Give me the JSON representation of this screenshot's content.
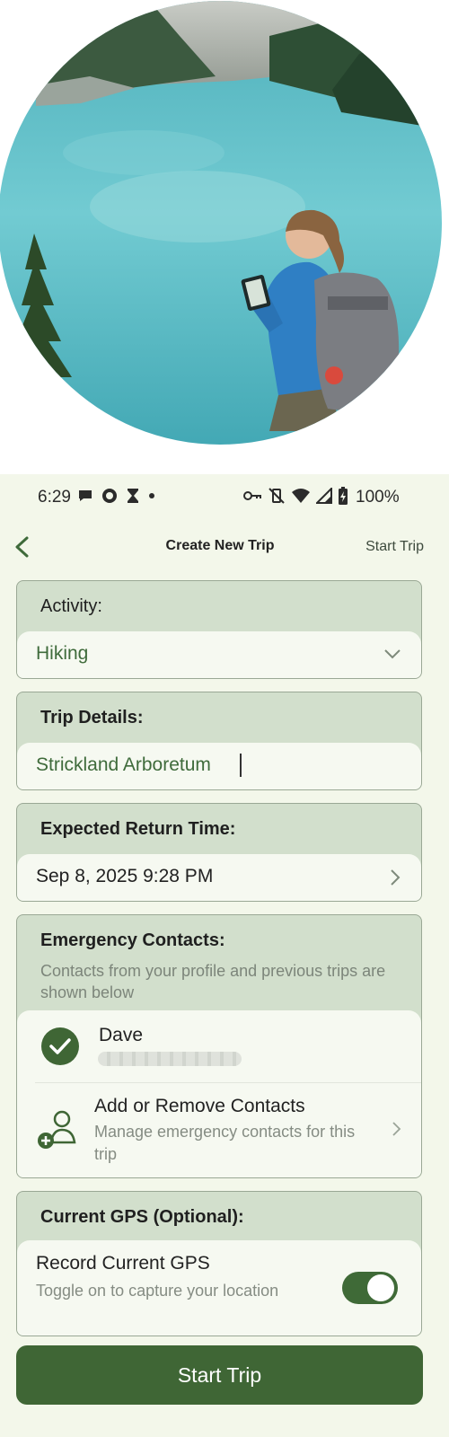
{
  "status_bar": {
    "time": "6:29",
    "battery": "100%",
    "icons_left": [
      "chat-bubble-icon",
      "gear-badge-icon",
      "hourglass-icon",
      "dot-icon"
    ],
    "icons_right": [
      "key-icon",
      "vibrate-off-icon",
      "wifi-icon",
      "signal-icon",
      "battery-icon"
    ]
  },
  "nav": {
    "title": "Create New Trip",
    "action": "Start Trip"
  },
  "activity": {
    "label": "Activity:",
    "value": "Hiking"
  },
  "trip_details": {
    "label": "Trip Details:",
    "value": "Strickland Arboretum"
  },
  "return_time": {
    "label": "Expected Return Time:",
    "value": "Sep 8, 2025 9:28 PM"
  },
  "emergency": {
    "label": "Emergency Contacts:",
    "hint": "Contacts from your profile and previous trips are shown below",
    "contacts": [
      {
        "name": "Dave",
        "selected": true
      }
    ],
    "manage": {
      "title": "Add or Remove Contacts",
      "subtitle": "Manage emergency contacts for this trip"
    }
  },
  "gps": {
    "label": "Current GPS (Optional):",
    "title": "Record Current GPS",
    "subtitle": "Toggle on to capture your location",
    "enabled": true
  },
  "primary_button": "Start Trip",
  "colors": {
    "app_background": "#f3f7ea",
    "card_background": "#d2dfcc",
    "accent_green": "#3f6635",
    "text_green": "#3f6b3b"
  }
}
